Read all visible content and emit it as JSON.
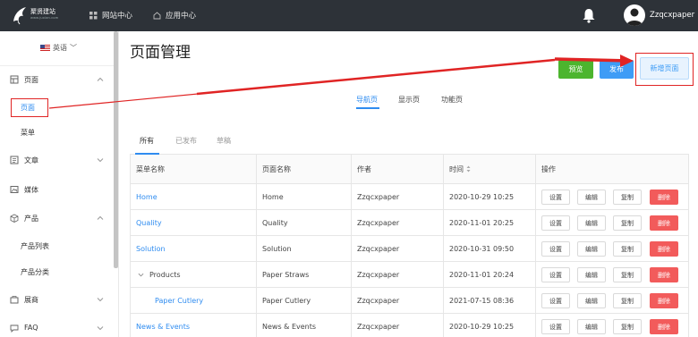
{
  "topbar": {
    "logo_text": "聚贤建站",
    "logo_sub": "www.juxian.com",
    "nav": [
      {
        "label": "网站中心"
      },
      {
        "label": "应用中心"
      }
    ],
    "username": "Zzqcxpaper"
  },
  "sidebar": {
    "language": "英语",
    "groups": [
      {
        "label": "页面",
        "icon": "page-icon"
      },
      {
        "label": "文章",
        "icon": "article-icon"
      },
      {
        "label": "媒体",
        "icon": "media-icon"
      },
      {
        "label": "产品",
        "icon": "product-icon"
      },
      {
        "label": "展商",
        "icon": "exhibitor-icon"
      },
      {
        "label": "FAQ",
        "icon": "faq-icon"
      }
    ],
    "sub": {
      "page": "页面",
      "menu": "菜单",
      "product_list": "产品列表",
      "product_category": "产品分类"
    }
  },
  "main": {
    "title": "页面管理",
    "buttons": {
      "preview": "预览",
      "publish": "发布",
      "new_page": "新增页面"
    },
    "subtabs": [
      "导航页",
      "显示页",
      "功能页"
    ],
    "status_tabs": [
      "所有",
      "已发布",
      "草稿"
    ],
    "table": {
      "headers": [
        "菜单名称",
        "页面名称",
        "作者",
        "时间",
        "操作"
      ],
      "actions": [
        "设置",
        "编辑",
        "复制",
        "删除"
      ],
      "rows": [
        {
          "menu": "Home",
          "page": "Home",
          "author": "Zzqcxpaper",
          "time": "2020-10-29 10:25"
        },
        {
          "menu": "Quality",
          "page": "Quality",
          "author": "Zzqcxpaper",
          "time": "2020-11-01 20:25"
        },
        {
          "menu": "Solution",
          "page": "Solution",
          "author": "Zzqcxpaper",
          "time": "2020-10-31 09:50"
        },
        {
          "menu": "Products",
          "page": "Paper Straws",
          "author": "Zzqcxpaper",
          "time": "2020-11-01 20:24"
        },
        {
          "menu": "Paper Cutlery",
          "page": "Paper Cutlery",
          "author": "Zzqcxpaper",
          "time": "2021-07-15 08:36"
        },
        {
          "menu": "News & Events",
          "page": "News & Events",
          "author": "Zzqcxpaper",
          "time": "2020-10-29 10:25"
        }
      ]
    }
  },
  "colors": {
    "accent": "#2f8cf0",
    "topbar": "#2d3238",
    "preview": "#4cb52e",
    "publish": "#3e9cf6",
    "delete": "#f25b5b",
    "annotation": "#e02424"
  }
}
